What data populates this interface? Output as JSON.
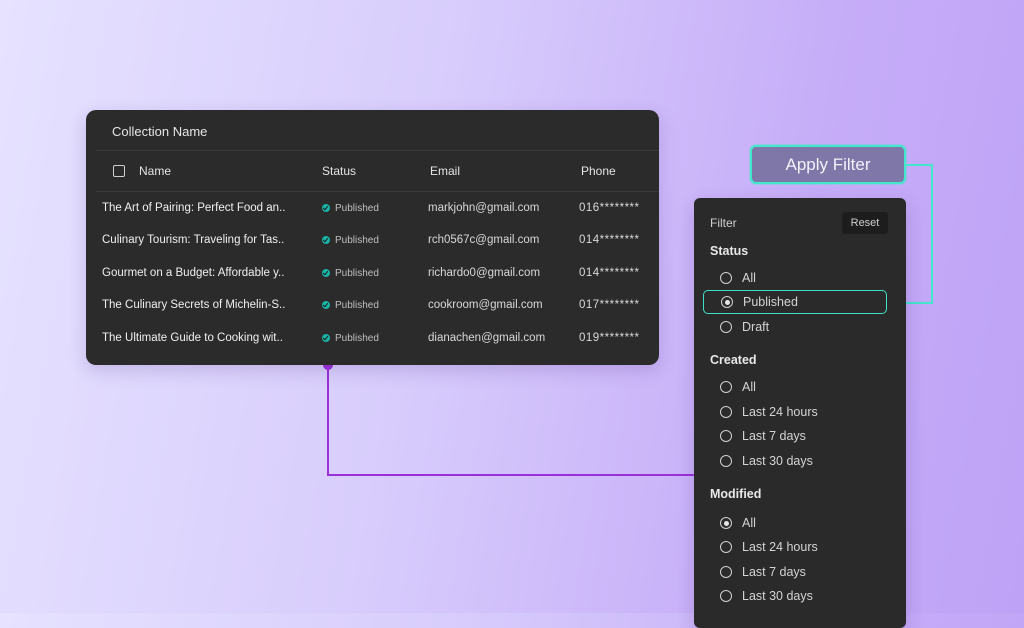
{
  "table": {
    "collection_name": "Collection Name",
    "headers": {
      "name": "Name",
      "status": "Status",
      "email": "Email",
      "phone": "Phone"
    },
    "rows": [
      {
        "name": "The Art of Pairing: Perfect Food an..",
        "status": "Published",
        "email": "markjohn@gmail.com",
        "phone": "016********"
      },
      {
        "name": "Culinary Tourism: Traveling for Tas..",
        "status": "Published",
        "email": "rch0567c@gmail.com",
        "phone": "014********"
      },
      {
        "name": "Gourmet on a Budget: Affordable y..",
        "status": "Published",
        "email": "richardo0@gmail.com",
        "phone": "014********"
      },
      {
        "name": "The Culinary Secrets of Michelin-S..",
        "status": "Published",
        "email": "cookroom@gmail.com",
        "phone": "017********"
      },
      {
        "name": "The Ultimate Guide to Cooking wit..",
        "status": "Published",
        "email": "dianachen@gmail.com",
        "phone": "019********"
      }
    ]
  },
  "apply_button": {
    "label": "Apply Filter"
  },
  "filter": {
    "title": "Filter",
    "reset_label": "Reset",
    "status": {
      "title": "Status",
      "options": [
        {
          "label": "All",
          "selected": false
        },
        {
          "label": "Published",
          "selected": true
        },
        {
          "label": "Draft",
          "selected": false
        }
      ]
    },
    "created": {
      "title": "Created",
      "options": [
        {
          "label": "All",
          "selected": false
        },
        {
          "label": "Last 24 hours",
          "selected": false
        },
        {
          "label": "Last 7 days",
          "selected": false
        },
        {
          "label": "Last 30 days",
          "selected": false
        }
      ]
    },
    "modified": {
      "title": "Modified",
      "options": [
        {
          "label": "All",
          "selected": true
        },
        {
          "label": "Last 24 hours",
          "selected": false
        },
        {
          "label": "Last 7 days",
          "selected": false
        },
        {
          "label": "Last 30 days",
          "selected": false
        }
      ]
    }
  },
  "colors": {
    "accent_teal": "#44e6cc",
    "accent_purple": "#9b30d9",
    "status_published": "#19b3a6"
  }
}
